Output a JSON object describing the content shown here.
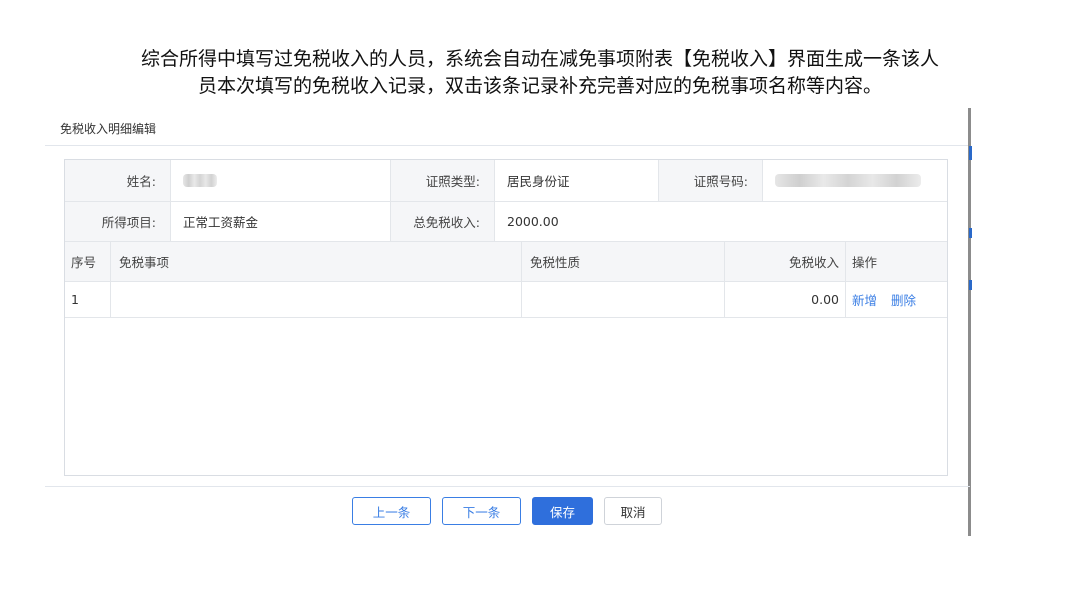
{
  "caption": {
    "line1": "综合所得中填写过免税收入的人员，系统会自动在减免事项附表【免税收入】界面生成一条该人",
    "line2": "员本次填写的免税收入记录，双击该条记录补充完善对应的免税事项名称等内容。"
  },
  "dialog": {
    "title": "免税收入明细编辑"
  },
  "info": {
    "name_label": "姓名:",
    "id_type_label": "证照类型:",
    "id_type_value": "居民身份证",
    "id_no_label": "证照号码:",
    "income_item_label": "所得项目:",
    "income_item_value": "正常工资薪金",
    "total_label": "总免税收入:",
    "total_value": "2000.00"
  },
  "table": {
    "headers": {
      "seq": "序号",
      "item": "免税事项",
      "nature": "免税性质",
      "income": "免税收入",
      "ops": "操作"
    },
    "rows": [
      {
        "seq": "1",
        "item": "",
        "nature": "",
        "income": "0.00",
        "add": "新增",
        "delete": "删除"
      }
    ]
  },
  "buttons": {
    "prev": "上一条",
    "next": "下一条",
    "save": "保存",
    "cancel": "取消"
  },
  "colors": {
    "accent": "#2f6fdc",
    "link": "#3a7ee4",
    "label_bg": "#f5f6f8"
  }
}
